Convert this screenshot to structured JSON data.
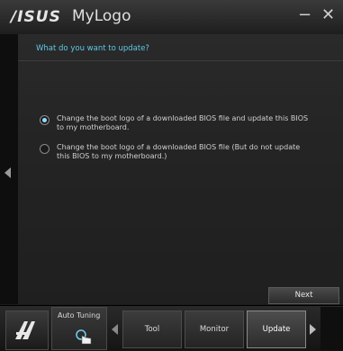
{
  "window": {
    "brand": "/ISUS",
    "title": "MyLogo",
    "minimize_glyph": "−",
    "close_glyph": "✕"
  },
  "update_panel": {
    "question": "What do you want to update?",
    "options": [
      {
        "label": "Change the boot logo of a downloaded BIOS file and update this BIOS to my motherboard.",
        "selected": true
      },
      {
        "label": "Change the boot logo of a downloaded BIOS file (But do not update this BIOS to my motherboard.)",
        "selected": false
      }
    ],
    "next_label": "Next"
  },
  "bottom_nav": {
    "auto_tuning_label": "Auto Tuning",
    "buttons": [
      "Tool",
      "Monitor",
      "Update"
    ],
    "active": "Update"
  },
  "colors": {
    "accent": "#5fc8e8",
    "background": "#1b1b1b"
  },
  "icons": [
    "ai-suite-logo-icon",
    "hand-pointer-icon",
    "chevron-left-icon",
    "chevron-right-icon"
  ]
}
